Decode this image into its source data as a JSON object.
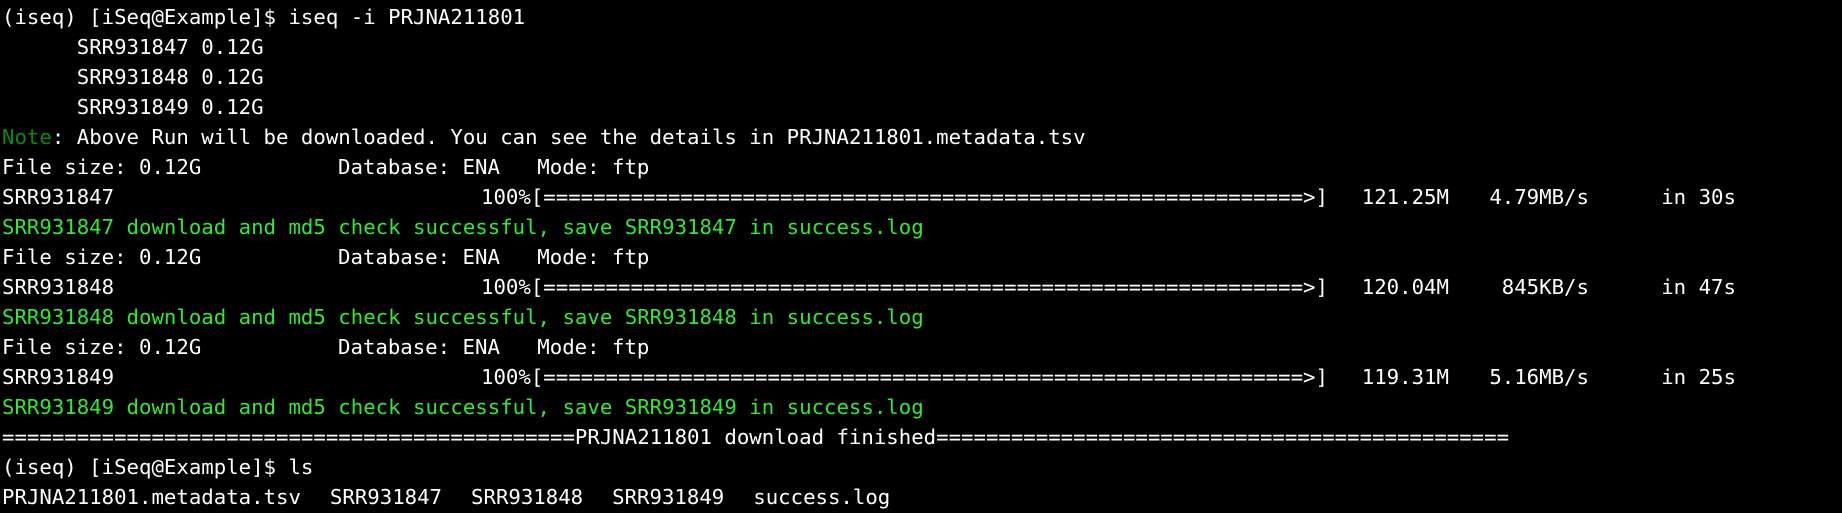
{
  "terminal": {
    "prompt": "(iseq) [iSeq@Example]$ ",
    "command1": "iseq -i PRJNA211801",
    "runs": [
      {
        "label": "SRR931847 0.12G"
      },
      {
        "label": "SRR931848 0.12G"
      },
      {
        "label": "SRR931849 0.12G"
      }
    ],
    "note_word": "Note",
    "note_rest": ": Above Run will be downloaded. You can see the details in PRJNA211801.metadata.tsv",
    "downloads": [
      {
        "file_size": "File size: 0.12G",
        "database": "Database: ENA",
        "mode": "Mode: ftp",
        "run": "SRR931847",
        "percent": "100%",
        "bar": "[=============================================================>]",
        "size": "121.25M",
        "speed": "4.79MB/s",
        "time": "in 30s",
        "success": "SRR931847 download and md5 check successful, save SRR931847 in success.log"
      },
      {
        "file_size": "File size: 0.12G",
        "database": "Database: ENA",
        "mode": "Mode: ftp",
        "run": "SRR931848",
        "percent": "100%",
        "bar": "[=============================================================>]",
        "size": "120.04M",
        "speed": "845KB/s",
        "time": "in 47s",
        "success": "SRR931848 download and md5 check successful, save SRR931848 in success.log"
      },
      {
        "file_size": "File size: 0.12G",
        "database": "Database: ENA",
        "mode": "Mode: ftp",
        "run": "SRR931849",
        "percent": "100%",
        "bar": "[=============================================================>]",
        "size": "119.31M",
        "speed": "5.16MB/s",
        "time": "in 25s",
        "success": "SRR931849 download and md5 check successful, save SRR931849 in success.log"
      }
    ],
    "finished_line": "==============================================PRJNA211801 download finished==============================================",
    "command2": "ls",
    "ls_output": [
      "PRJNA211801.metadata.tsv",
      "SRR931847",
      "SRR931848",
      "SRR931849",
      "success.log"
    ],
    "colors": {
      "background": "#000000",
      "text": "#ffffff",
      "note": "#0a8a0a",
      "success": "#33e833"
    }
  }
}
